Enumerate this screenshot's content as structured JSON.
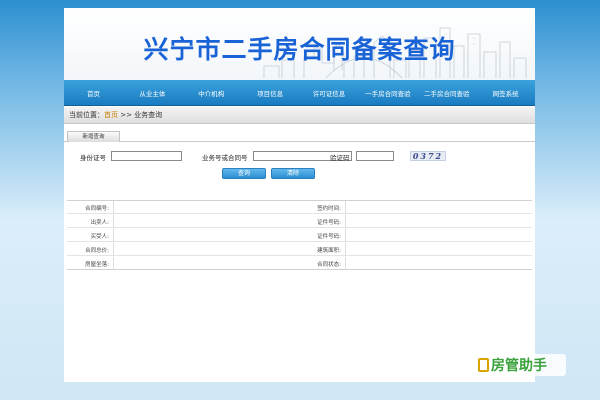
{
  "banner": {
    "title": "兴宁市二手房合同备案查询"
  },
  "nav": {
    "items": [
      "首页",
      "从业主体",
      "中介机构",
      "项目信息",
      "许可证信息",
      "一手房合同查验",
      "二手房合同查验",
      "网签系统"
    ]
  },
  "breadcrumb": {
    "prefix": "当前位置：",
    "home": "首页",
    "sep": " >> ",
    "current": "业务查询"
  },
  "tab": {
    "label": "新增查询"
  },
  "form": {
    "id_label": "身份证号",
    "id_value": "",
    "biz_label": "业务号或合同号",
    "biz_value": "",
    "code_label": "验证码",
    "code_value": "",
    "captcha_text": "0372",
    "query_button": "查询",
    "clear_button": "清除"
  },
  "result": {
    "rows": [
      {
        "left_label": "合同编号:",
        "right_label": "签约时间:"
      },
      {
        "left_label": "出卖人:",
        "right_label": "证件号码:"
      },
      {
        "left_label": "买受人:",
        "right_label": "证件号码:"
      },
      {
        "left_label": "合同总价:",
        "right_label": "建筑面积:"
      },
      {
        "left_label": "房屋坐落:",
        "right_label": "合同状态:"
      }
    ]
  },
  "watermark": {
    "text": "房管助手"
  },
  "colors": {
    "accent": "#1a63d6",
    "nav": "#1a7bc1",
    "button": "#2b8fd2"
  }
}
